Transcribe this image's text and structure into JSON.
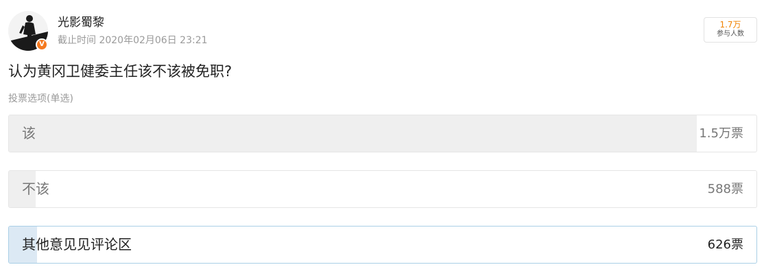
{
  "header": {
    "username": "光影蜀黎",
    "verified_badge": "V",
    "deadline": "截止时间 2020年02月06日 23:21",
    "participants_count": "1.7万",
    "participants_label": "参与人数"
  },
  "question": "认为黄冈卫健委主任该不该被免职?",
  "poll_type": "投票选项(单选)",
  "options": [
    {
      "label": "该",
      "votes": "1.5万票",
      "fraction": 0.92,
      "selected": false
    },
    {
      "label": "不该",
      "votes": "588票",
      "fraction": 0.036,
      "selected": false
    },
    {
      "label": "其他意见见评论区",
      "votes": "626票",
      "fraction": 0.038,
      "selected": true
    }
  ],
  "colors": {
    "accent_orange": "#f08300",
    "bar_fill": "#efefef",
    "selected_fill": "#dce9f4",
    "selected_border": "#a9cfe6"
  },
  "icons": {
    "avatar": "silhouette-avatar-icon",
    "verified": "verified-badge-icon"
  }
}
